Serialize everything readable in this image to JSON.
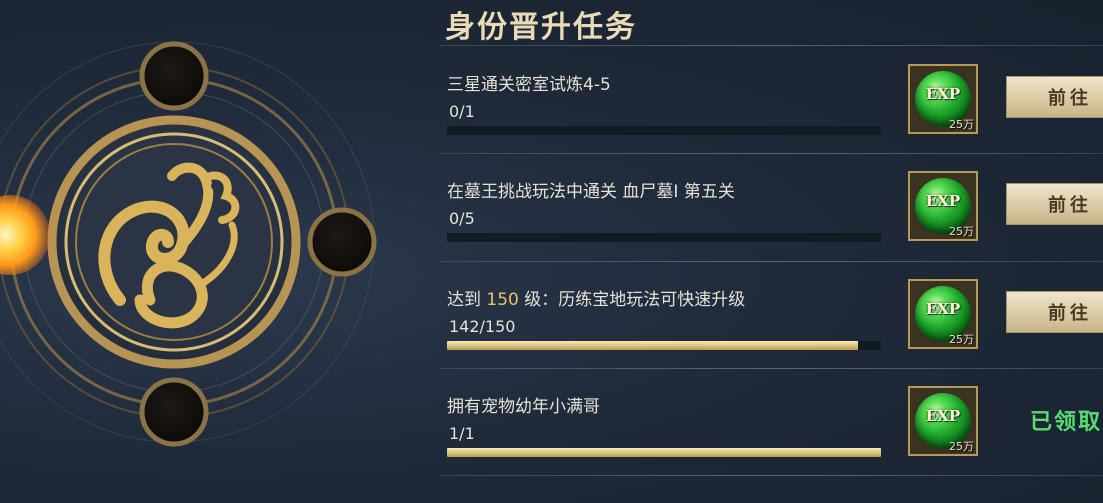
{
  "panel": {
    "title": "身份晋升任务"
  },
  "tasks": [
    {
      "title": "三星通关密室试炼4-5",
      "progress_text": "0/1",
      "progress": 0.0,
      "reward": {
        "label": "EXP",
        "quantity": "25万"
      },
      "action": "前往"
    },
    {
      "title": "在墓王挑战玩法中通关 血尸墓I 第五关",
      "progress_text": "0/5",
      "progress": 0.0,
      "reward": {
        "label": "EXP",
        "quantity": "25万"
      },
      "action": "前往"
    },
    {
      "title_prefix": "达到 ",
      "title_highlight": "150",
      "title_suffix": " 级：历练宝地玩法可快速升级",
      "progress_text": "142/150",
      "progress": 0.9467,
      "reward": {
        "label": "EXP",
        "quantity": "25万"
      },
      "action": "前往"
    },
    {
      "title": "拥有宠物幼年小满哥",
      "progress_text": "1/1",
      "progress": 1.0,
      "reward": {
        "label": "EXP",
        "quantity": "25万"
      },
      "status": "已领取"
    }
  ],
  "colors": {
    "accent_gold": "#b79a55",
    "claimed_green": "#56dd72",
    "highlight": "#e6c36a"
  },
  "icons": {
    "emblem": "golden-dragon-emblem",
    "reward": "exp-orb-icon"
  }
}
